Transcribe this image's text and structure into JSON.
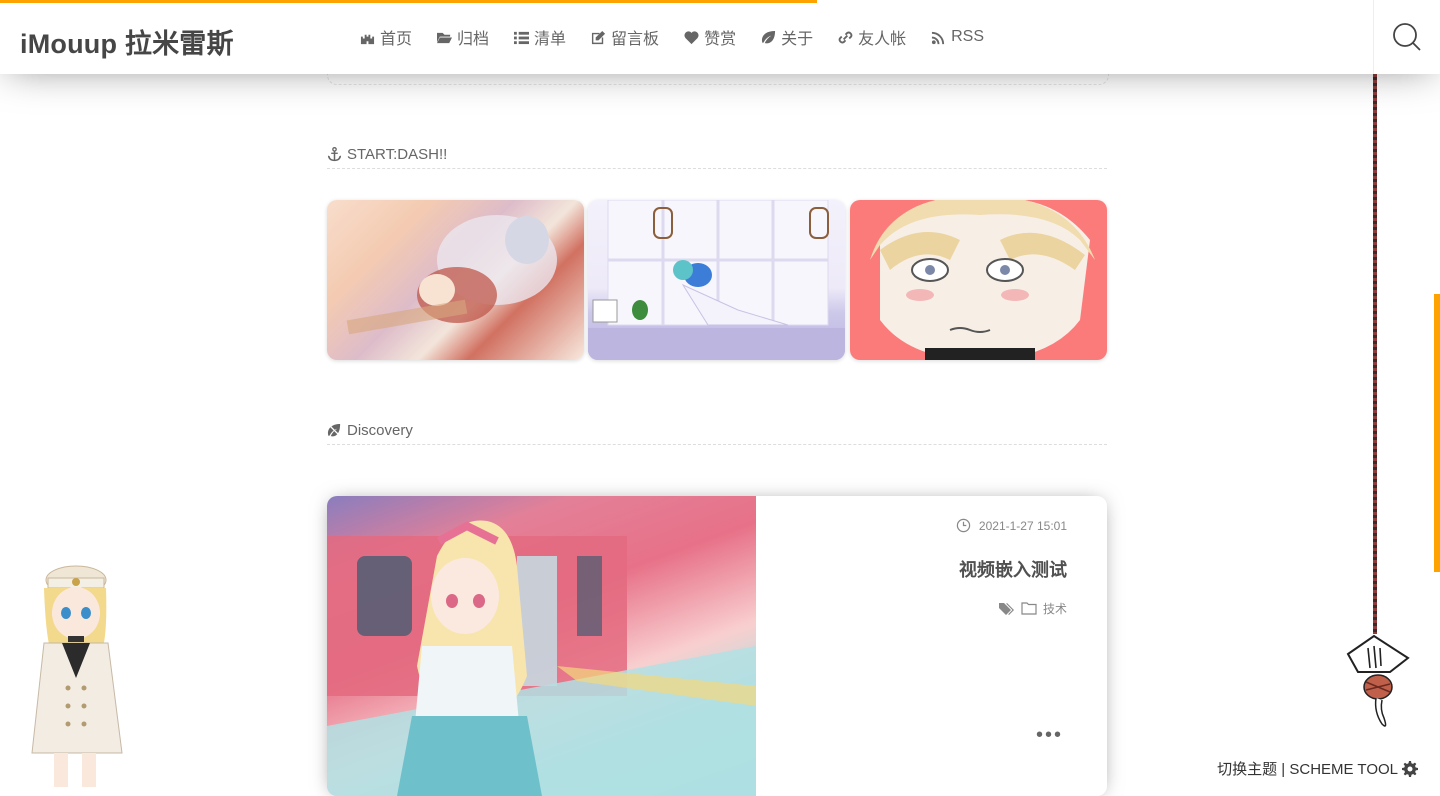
{
  "site": {
    "title": "iMouup 拉米雷斯"
  },
  "nav": [
    {
      "label": "首页",
      "icon": "castle-icon"
    },
    {
      "label": "归档",
      "icon": "folder-open-icon"
    },
    {
      "label": "清单",
      "icon": "list-icon"
    },
    {
      "label": "留言板",
      "icon": "edit-icon"
    },
    {
      "label": "赞赏",
      "icon": "heart-icon"
    },
    {
      "label": "关于",
      "icon": "leaf-icon"
    },
    {
      "label": "友人帐",
      "icon": "link-icon"
    },
    {
      "label": "RSS",
      "icon": "rss-icon"
    }
  ],
  "sections": {
    "feature_title": "START:DASH!!",
    "discovery_title": "Discovery"
  },
  "post": {
    "date": "2021-1-27 15:01",
    "title": "视频嵌入测试",
    "category": "技术",
    "more": "•••"
  },
  "theme_tool": {
    "label": "切换主题 | SCHEME TOOL"
  },
  "colors": {
    "accent": "#fea200",
    "header_text": "#464646",
    "card3_bg": "#fb7b7b"
  },
  "progress": 0.567
}
